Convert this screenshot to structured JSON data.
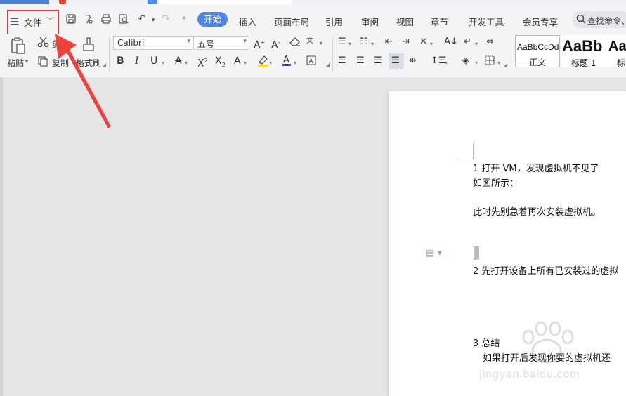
{
  "menubar": {
    "file_label": "文件",
    "tabs": [
      "开始",
      "插入",
      "页面布局",
      "引用",
      "审阅",
      "视图",
      "章节",
      "开发工具",
      "会员专享"
    ],
    "search_placeholder": "查找命令、"
  },
  "ribbon": {
    "paste_label": "粘贴",
    "cut_label": "剪切",
    "copy_label": "复制",
    "format_painter_label": "格式刷",
    "font_name": "Calibri",
    "font_size": "五号",
    "styles": [
      {
        "preview": "AaBbCcDd",
        "label": "正文"
      },
      {
        "preview": "AaBb",
        "label": "标题 1"
      },
      {
        "preview": "Aa",
        "label": "标"
      }
    ]
  },
  "document": {
    "lines": [
      "1 打开 VM，发现虚拟机不见了",
      "如图所示：",
      "此时先别急着再次安装虚拟机。",
      "2 先打开设备上所有已安装过的虚拟",
      "3 总结",
      "如果打开后发现你要的虚拟机还"
    ]
  },
  "watermark": {
    "text": "jingyan.baidu.com"
  },
  "colors": {
    "accent": "#4a86e8",
    "highlight_box": "#e53935",
    "arrow": "#f0413a"
  }
}
